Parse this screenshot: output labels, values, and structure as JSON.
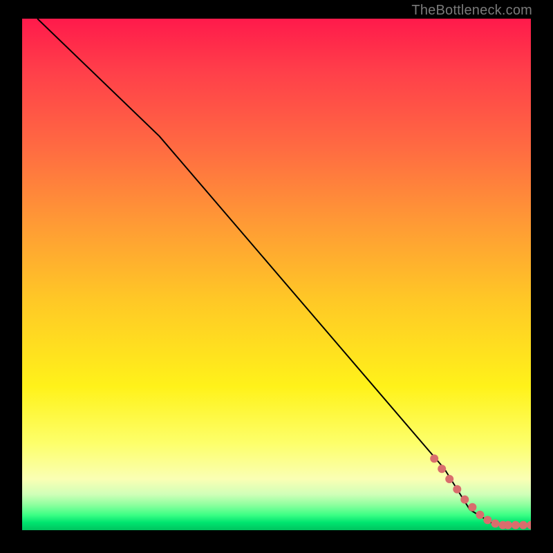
{
  "watermark": "TheBottleneck.com",
  "chart_data": {
    "type": "line",
    "title": "",
    "xlabel": "",
    "ylabel": "",
    "xlim": [
      0,
      100
    ],
    "ylim": [
      0,
      100
    ],
    "axes_visible": false,
    "background": "rainbow-gradient-vertical",
    "series": [
      {
        "name": "curve",
        "style": "line",
        "color": "#000000",
        "x": [
          3,
          27,
          83,
          88,
          93,
          100
        ],
        "y": [
          100,
          77,
          12,
          4,
          1,
          1
        ]
      },
      {
        "name": "points",
        "style": "scatter",
        "color": "#d96d6d",
        "x": [
          81,
          82.5,
          84,
          85.5,
          87,
          88.5,
          90,
          91.5,
          93,
          94.5,
          95.5,
          97,
          98.5,
          100
        ],
        "y": [
          14,
          12,
          10,
          8,
          6,
          4.5,
          3,
          2,
          1.3,
          1,
          1,
          1,
          1,
          1
        ]
      }
    ]
  }
}
